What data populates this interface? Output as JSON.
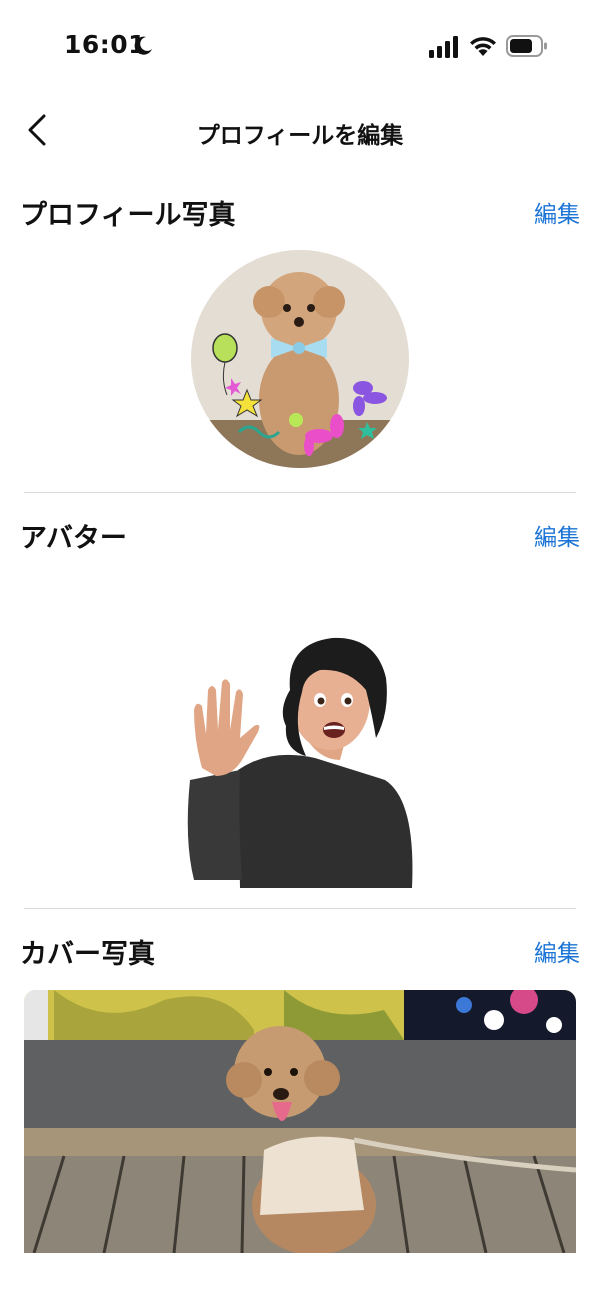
{
  "status_bar": {
    "time": "16:01",
    "icons": [
      "moon-icon",
      "signal-icon",
      "wifi-icon",
      "battery-icon"
    ]
  },
  "nav": {
    "title": "プロフィールを編集",
    "back_icon": "chevron-left-icon"
  },
  "sections": {
    "profile_photo": {
      "title": "プロフィール写真",
      "edit_label": "編集"
    },
    "avatar": {
      "title": "アバター",
      "edit_label": "編集"
    },
    "cover_photo": {
      "title": "カバー写真",
      "edit_label": "編集"
    }
  },
  "colors": {
    "accent": "#1b74d6",
    "text": "#111111",
    "divider": "#dcdcdc"
  }
}
